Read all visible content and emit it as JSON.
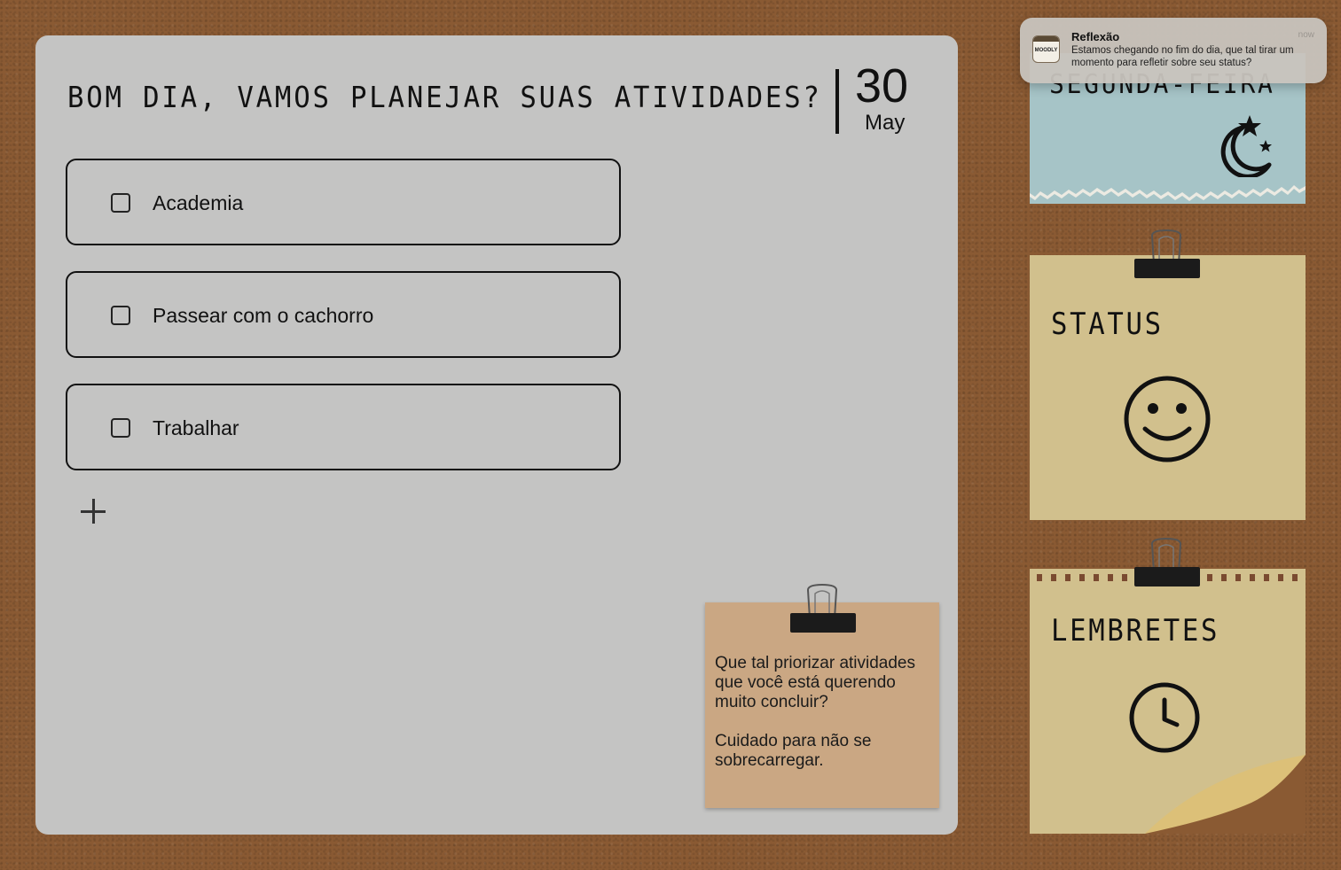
{
  "planner": {
    "greeting": "BOM DIA, VAMOS PLANEJAR SUAS ATIVIDADES?",
    "date_day": "30",
    "date_month": "May",
    "tasks": [
      {
        "label": "Academia",
        "checked": false
      },
      {
        "label": "Passear com o cachorro",
        "checked": false
      },
      {
        "label": "Trabalhar",
        "checked": false
      }
    ],
    "add_icon": "plus-icon"
  },
  "tip_note": {
    "text1": "Que tal priorizar atividades que você está querendo muito concluir?",
    "text2": "Cuidado para não se sobrecarregar."
  },
  "day_card": {
    "title": "SEGUNDA-FEIRA",
    "icon": "moon-stars-icon"
  },
  "status_card": {
    "title": "STATUS",
    "icon": "smiley-icon"
  },
  "reminders_card": {
    "title": "LEMBRETES",
    "icon": "clock-icon"
  },
  "notification": {
    "app_icon_text": "MOODLY",
    "title": "Reflexão",
    "time": "now",
    "body": "Estamos chegando no fim do dia, que tal tirar um momento para refletir sobre seu status?"
  },
  "colors": {
    "cork": "#8a5a33",
    "panel": "#c4c4c3",
    "tip_note": "#caa783",
    "blue_card": "#a6c4c7",
    "yellow_card": "#d1c08d"
  }
}
